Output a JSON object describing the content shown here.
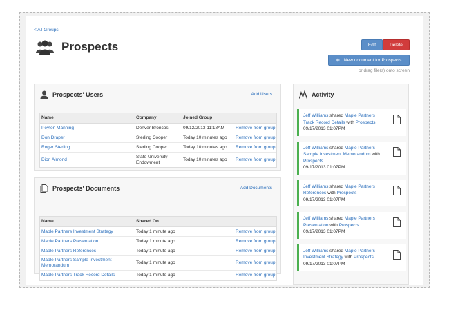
{
  "nav": {
    "back": "< All Groups"
  },
  "page": {
    "title": "Prospects"
  },
  "buttons": {
    "edit": "Edit",
    "delete": "Delete",
    "new_doc": "New document for Prospects",
    "new_doc_icon": "plus-icon"
  },
  "drag_hint": "or drag file(s) onto screen",
  "users": {
    "title": "Prospects' Users",
    "add": "Add Users",
    "columns": [
      "Name",
      "Company",
      "Joined Group"
    ],
    "rows": [
      {
        "name": "Peyton Manning",
        "company": "Denver Broncos",
        "joined": "09/12/2013 11:18AM",
        "action": "Remove from group"
      },
      {
        "name": "Don Draper",
        "company": "Sterling Cooper",
        "joined": "Today 10 minutes ago",
        "action": "Remove from group"
      },
      {
        "name": "Roger Sterling",
        "company": "Sterling Cooper",
        "joined": "Today 10 minutes ago",
        "action": "Remove from group"
      },
      {
        "name": "Dion Almond",
        "company": "State University Endowment",
        "joined": "Today 10 minutes ago",
        "action": "Remove from group"
      }
    ]
  },
  "documents": {
    "title": "Prospects' Documents",
    "add": "Add Documents",
    "columns": [
      "Name",
      "Shared On"
    ],
    "rows": [
      {
        "name": "Maple Partners Investment Strategy",
        "shared": "Today 1 minute ago",
        "action": "Remove from group"
      },
      {
        "name": "Maple Partners Presentation",
        "shared": "Today 1 minute ago",
        "action": "Remove from group"
      },
      {
        "name": "Maple Partners References",
        "shared": "Today 1 minute ago",
        "action": "Remove from group"
      },
      {
        "name": "Maple Partners Sample Investment Memorandum",
        "shared": "Today 1 minute ago",
        "action": "Remove from group"
      },
      {
        "name": "Maple Partners Track Record Details",
        "shared": "Today 1 minute ago",
        "action": "Remove from group"
      }
    ]
  },
  "activity": {
    "title": "Activity",
    "items": [
      {
        "user": "Jeff Williams",
        "verb": "shared",
        "doc": "Maple Partners Track Record Details",
        "with": "with",
        "group": "Prospects",
        "time": "09/17/2013 01:07PM"
      },
      {
        "user": "Jeff Williams",
        "verb": "shared",
        "doc": "Maple Partners Sample Investment Memorandum",
        "with": "with",
        "group": "Prospects",
        "time": "09/17/2013 01:07PM"
      },
      {
        "user": "Jeff Williams",
        "verb": "shared",
        "doc": "Maple Partners References",
        "with": "with",
        "group": "Prospects",
        "time": "09/17/2013 01:07PM"
      },
      {
        "user": "Jeff Williams",
        "verb": "shared",
        "doc": "Maple Partners Presentation",
        "with": "with",
        "group": "Prospects",
        "time": "09/17/2013 01:07PM"
      },
      {
        "user": "Jeff Williams",
        "verb": "shared",
        "doc": "Maple Partners Investment Strategy",
        "with": "with",
        "group": "Prospects",
        "time": "09/17/2013 01:07PM"
      }
    ]
  },
  "icons": {
    "group": "group-icon",
    "user": "user-icon",
    "documents": "documents-icon",
    "activity": "activity-icon",
    "document": "document-icon"
  },
  "colors": {
    "link": "#2a6ebb",
    "primary": "#5b8ec8",
    "danger": "#d13c3c",
    "activity_accent": "#4cb050"
  }
}
